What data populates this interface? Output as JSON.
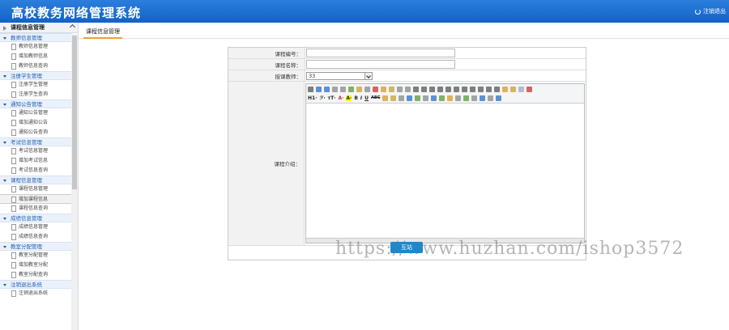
{
  "header": {
    "title": "高校教务网络管理系统",
    "logout_label": "注销退出"
  },
  "sidebar": {
    "title": "课程信息管理",
    "groups": [
      {
        "title": "教师信息管理",
        "items": [
          "教师信息管理",
          "增加教师信息",
          "教师信息查询"
        ]
      },
      {
        "title": "注册学生管理",
        "items": [
          "注册学生管理",
          "注册学生查询"
        ]
      },
      {
        "title": "通知公告管理",
        "items": [
          "通知公告管理",
          "增加通知公告",
          "通知公告查询"
        ]
      },
      {
        "title": "考试信息管理",
        "items": [
          "考试信息管理",
          "增加考试信息",
          "考试信息查询"
        ]
      },
      {
        "title": "课程信息管理",
        "items": [
          "课程信息管理",
          "增加课程信息",
          "课程信息查询"
        ]
      },
      {
        "title": "成绩信息管理",
        "items": [
          "成绩信息管理",
          "成绩信息查询"
        ]
      },
      {
        "title": "教室分配管理",
        "items": [
          "教室分配管理",
          "增加教室分配",
          "教室分配查询"
        ]
      },
      {
        "title": "注销退出系统",
        "items": [
          "注销退出系统"
        ]
      }
    ]
  },
  "tabs": {
    "active": "课程信息管理"
  },
  "form": {
    "course_no_label": "课程编号：",
    "course_name_label": "课程名称：",
    "teacher_label": "授课教师：",
    "teacher_value": "33",
    "intro_label": "课程介绍："
  },
  "editor": {
    "heading_btn": "H1·",
    "font_btn": "ℱ·",
    "size_btn": "ᴛT·",
    "color_btn": "A·",
    "bold": "B",
    "italic": "I",
    "underline": "U",
    "strike": "ABC"
  },
  "watermark": {
    "text": "https://www.huzhan.com/ishop3572",
    "logo_text": "互站"
  }
}
